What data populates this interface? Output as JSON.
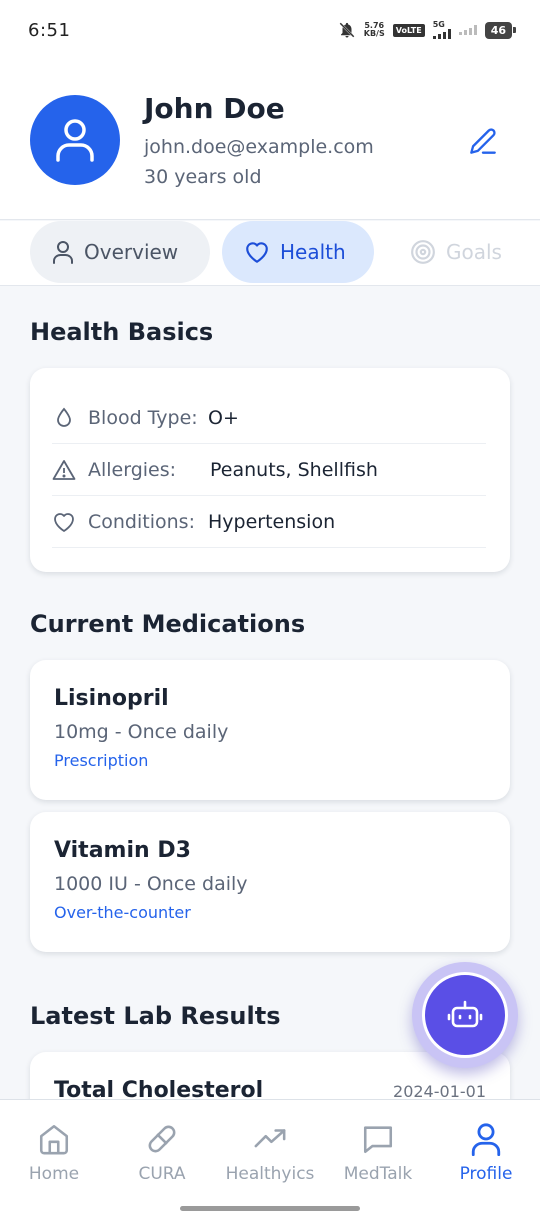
{
  "status_bar": {
    "time": "6:51",
    "net_speed_value": "5.76",
    "net_speed_unit": "KB/S",
    "volte": "VoLTE",
    "network": "5G",
    "battery": "46"
  },
  "profile": {
    "name": "John Doe",
    "email": "john.doe@example.com",
    "age": "30 years old"
  },
  "tabs": [
    {
      "label": "Overview",
      "icon": "person-icon"
    },
    {
      "label": "Health",
      "icon": "heart-icon",
      "active": true
    },
    {
      "label": "Goals",
      "icon": "target-icon"
    }
  ],
  "health_basics": {
    "title": "Health Basics",
    "rows": [
      {
        "label": "Blood Type:",
        "value": "O+",
        "icon": "drop-icon"
      },
      {
        "label": "Allergies:",
        "value": "Peanuts, Shellfish",
        "icon": "warning-icon"
      },
      {
        "label": "Conditions:",
        "value": "Hypertension",
        "icon": "heart-icon"
      }
    ]
  },
  "medications": {
    "title": "Current Medications",
    "items": [
      {
        "name": "Lisinopril",
        "dose": "10mg - Once daily",
        "type": "Prescription"
      },
      {
        "name": "Vitamin D3",
        "dose": "1000 IU - Once daily",
        "type": "Over-the-counter"
      }
    ]
  },
  "lab_results": {
    "title": "Latest Lab Results",
    "items": [
      {
        "name": "Total Cholesterol",
        "date": "2024-01-01"
      }
    ]
  },
  "fab": {
    "icon": "robot-icon"
  },
  "bottom_nav": [
    {
      "label": "Home",
      "icon": "home-icon"
    },
    {
      "label": "CURA",
      "icon": "pill-icon"
    },
    {
      "label": "Healthyics",
      "icon": "trending-up-icon"
    },
    {
      "label": "MedTalk",
      "icon": "chat-icon"
    },
    {
      "label": "Profile",
      "icon": "person-icon",
      "active": true
    }
  ],
  "colors": {
    "primary": "#2563eb",
    "fab": "#5a4fe6",
    "background": "#f5f7fa"
  }
}
